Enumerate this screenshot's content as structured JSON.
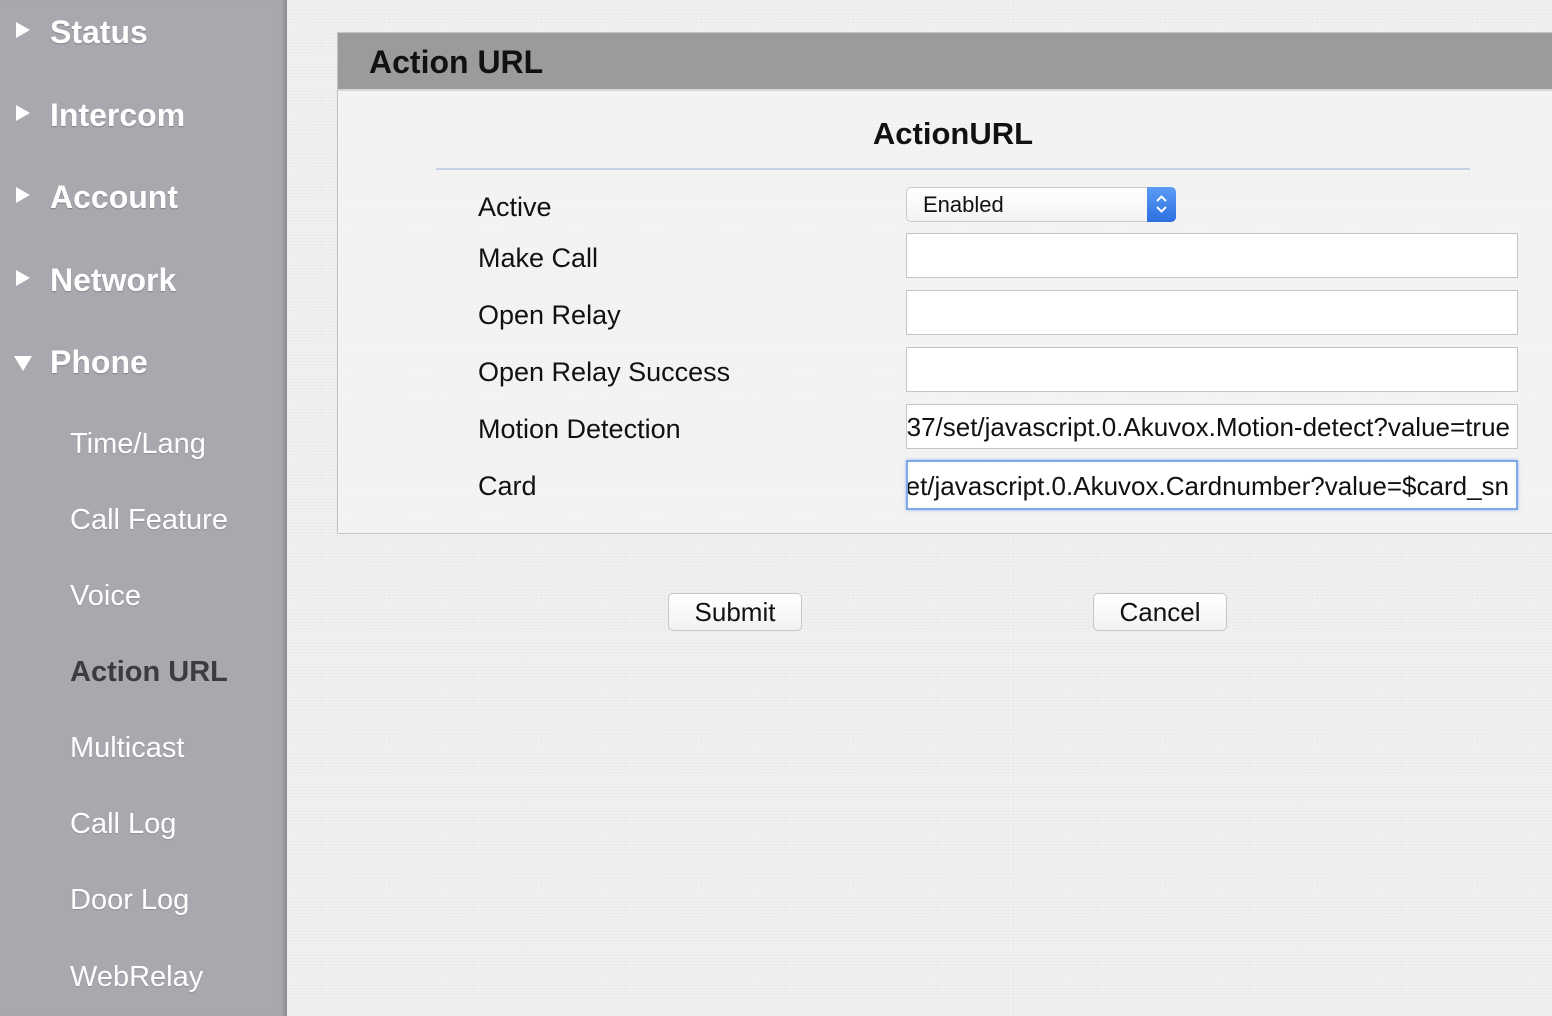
{
  "sidebar": {
    "top_items": [
      {
        "label": "Status",
        "expanded": false
      },
      {
        "label": "Intercom",
        "expanded": false
      },
      {
        "label": "Account",
        "expanded": false
      },
      {
        "label": "Network",
        "expanded": false
      },
      {
        "label": "Phone",
        "expanded": true
      }
    ],
    "sub_items": [
      {
        "label": "Time/Lang"
      },
      {
        "label": "Call Feature"
      },
      {
        "label": "Voice"
      },
      {
        "label": "Action URL",
        "active": true
      },
      {
        "label": "Multicast"
      },
      {
        "label": "Call Log"
      },
      {
        "label": "Door Log"
      },
      {
        "label": "WebRelay"
      }
    ]
  },
  "panel": {
    "title": "Action URL",
    "section_title": "ActionURL",
    "fields": {
      "active": {
        "label": "Active",
        "value": "Enabled"
      },
      "make_call": {
        "label": "Make Call",
        "value": ""
      },
      "open_relay": {
        "label": "Open Relay",
        "value": ""
      },
      "open_relay_success": {
        "label": "Open Relay Success",
        "value": ""
      },
      "motion_detection": {
        "label": "Motion Detection",
        "value": "37/set/javascript.0.Akuvox.Motion-detect?value=true"
      },
      "card": {
        "label": "Card",
        "value": "et/javascript.0.Akuvox.Cardnumber?value=$card_sn"
      }
    }
  },
  "buttons": {
    "submit": "Submit",
    "cancel": "Cancel"
  },
  "colors": {
    "sidebar_bg": "#a8a9ae",
    "header_bg": "#9b9b9b",
    "select_accent": "#2d6fe0",
    "focus_ring": "#7fa9e8"
  }
}
